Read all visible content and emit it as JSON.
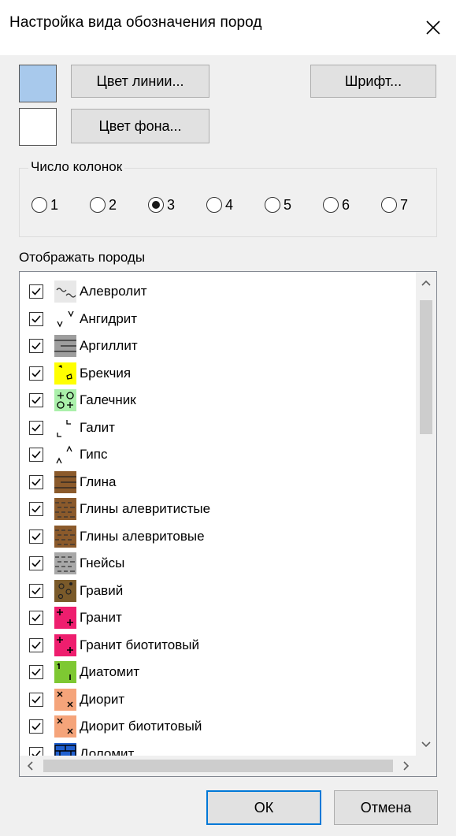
{
  "dialog": {
    "title": "Настройка вида обозначения пород",
    "close_icon": "close-icon"
  },
  "colors": {
    "line_swatch": "#a8c9ec",
    "bg_swatch": "#ffffff",
    "accent": "#0078d7"
  },
  "buttons": {
    "line_color": "Цвет линии...",
    "font": "Шрифт...",
    "bg_color": "Цвет фона...",
    "ok": "ОК",
    "cancel": "Отмена"
  },
  "columns": {
    "label": "Число колонок",
    "options": [
      "1",
      "2",
      "3",
      "4",
      "5",
      "6",
      "7"
    ],
    "selected": "3"
  },
  "rocks": {
    "label": "Отображать породы",
    "items": [
      {
        "name": "Алевролит",
        "checked": true,
        "fill": "#e8e8e8",
        "pattern": "wave"
      },
      {
        "name": "Ангидрит",
        "checked": true,
        "fill": "#ffffff",
        "pattern": "v"
      },
      {
        "name": "Аргиллит",
        "checked": true,
        "fill": "#9e9e9e",
        "pattern": "lines"
      },
      {
        "name": "Брекчия",
        "checked": true,
        "fill": "#ffff00",
        "pattern": "brec"
      },
      {
        "name": "Галечник",
        "checked": true,
        "fill": "#aaf0aa",
        "pattern": "pebble"
      },
      {
        "name": "Галит",
        "checked": true,
        "fill": "#ffffff",
        "pattern": "halite"
      },
      {
        "name": "Гипс",
        "checked": true,
        "fill": "#ffffff",
        "pattern": "gyps"
      },
      {
        "name": "Глина",
        "checked": true,
        "fill": "#8b5a2b",
        "pattern": "lines"
      },
      {
        "name": "Глины алевритистые",
        "checked": true,
        "fill": "#8b5a2b",
        "pattern": "dash"
      },
      {
        "name": "Глины алевритовые",
        "checked": true,
        "fill": "#8b5a2b",
        "pattern": "dash"
      },
      {
        "name": "Гнейсы",
        "checked": true,
        "fill": "#a8a8a8",
        "pattern": "dash"
      },
      {
        "name": "Гравий",
        "checked": true,
        "fill": "#7a5a2a",
        "pattern": "gravel"
      },
      {
        "name": "Гранит",
        "checked": true,
        "fill": "#ee1e6e",
        "pattern": "plus"
      },
      {
        "name": "Гранит биотитовый",
        "checked": true,
        "fill": "#ee1e6e",
        "pattern": "plus"
      },
      {
        "name": "Диатомит",
        "checked": true,
        "fill": "#7ec832",
        "pattern": "diat"
      },
      {
        "name": "Диорит",
        "checked": true,
        "fill": "#f5a47a",
        "pattern": "x"
      },
      {
        "name": "Диорит биотитовый",
        "checked": true,
        "fill": "#f5a47a",
        "pattern": "x"
      },
      {
        "name": "Доломит",
        "checked": true,
        "fill": "#2060d0",
        "pattern": "brick"
      }
    ]
  }
}
